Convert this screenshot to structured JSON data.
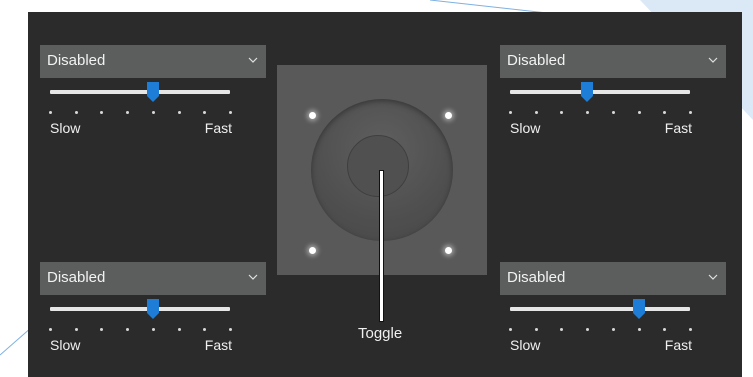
{
  "panel": {
    "background": "#2b2b2b"
  },
  "controls": [
    {
      "id": "top-left",
      "dropdown_value": "Disabled",
      "slider_value": 4,
      "slider_max": 7,
      "label_slow": "Slow",
      "label_fast": "Fast"
    },
    {
      "id": "top-right",
      "dropdown_value": "Disabled",
      "slider_value": 3,
      "slider_max": 7,
      "label_slow": "Slow",
      "label_fast": "Fast"
    },
    {
      "id": "bottom-left",
      "dropdown_value": "Disabled",
      "slider_value": 4,
      "slider_max": 7,
      "label_slow": "Slow",
      "label_fast": "Fast"
    },
    {
      "id": "bottom-right",
      "dropdown_value": "Disabled",
      "slider_value": 5,
      "slider_max": 7,
      "label_slow": "Slow",
      "label_fast": "Fast"
    }
  ],
  "pad": {
    "toggle_label": "Toggle"
  },
  "colors": {
    "accent": "#1e7dd6",
    "track": "#e6e6e6",
    "dropdown_bg": "#5b5e5c"
  }
}
